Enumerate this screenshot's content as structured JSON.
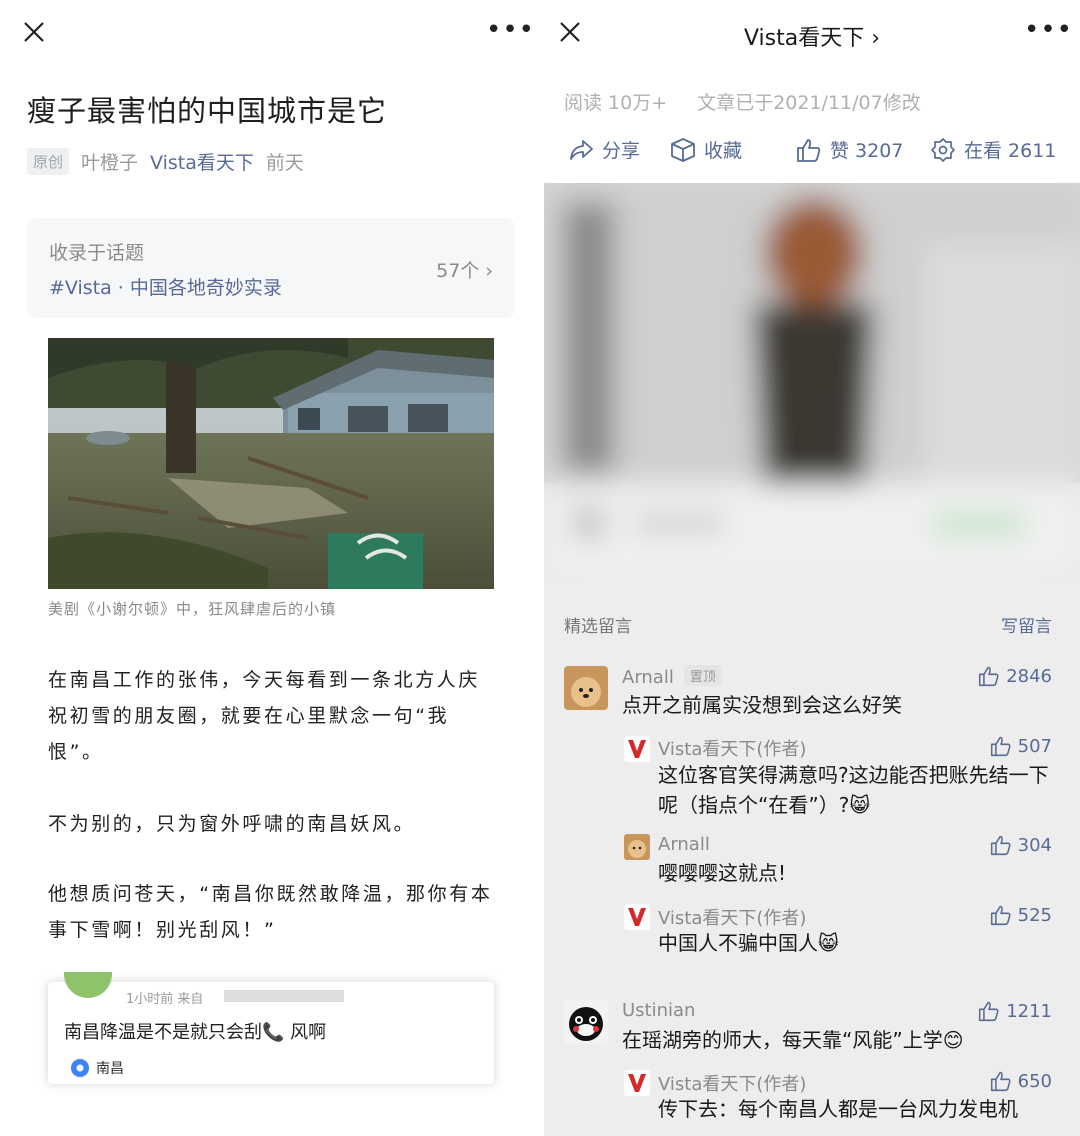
{
  "left": {
    "title": "瘦子最害怕的中国城市是它",
    "meta": {
      "original_tag": "原创",
      "author": "叶橙子",
      "account": "Vista看天下",
      "time": "前天"
    },
    "topic": {
      "label": "收录于话题",
      "name": "#Vista · 中国各地奇妙实录",
      "count": "57个 ›"
    },
    "photo_caption": "美剧《小谢尔顿》中，狂风肆虐后的小镇",
    "paragraphs": [
      "在南昌工作的张伟，今天每看到一条北方人庆祝初雪的朋友圈，就要在心里默念一句“我恨”。",
      "不为别的，只为窗外呼啸的南昌妖风。",
      "他想质问苍天，“南昌你既然敢降温，那你有本事下雪啊！别光刮风！”"
    ],
    "embed": {
      "time": "1小时前  来自",
      "text": "南昌降温是不是就只会刮📞 风啊",
      "location": "南昌"
    }
  },
  "right": {
    "header_title": "Vista看天下 ›",
    "stats": {
      "reads": "阅读 10万+",
      "modified": "文章已于2021/11/07修改"
    },
    "actions": {
      "share": "分享",
      "collect": "收藏",
      "like": "赞 3207",
      "watching": "在看 2611"
    },
    "section_title": "精选留言",
    "write_comment": "写留言",
    "comments": [
      {
        "name": "Arnall",
        "pin": "置顶",
        "likes": "2846",
        "text": "点开之前属实没想到会这么好笑"
      },
      {
        "name": "Vista看天下(作者)",
        "likes": "507",
        "text": "这位客官笑得满意吗?这边能否把账先结一下呢（指点个“在看”）?😸"
      },
      {
        "name": "Arnall",
        "likes": "304",
        "text": "嘤嘤嘤这就点!"
      },
      {
        "name": "Vista看天下(作者)",
        "likes": "525",
        "text": "中国人不骗中国人😸"
      },
      {
        "name": "Ustinian",
        "likes": "1211",
        "text": "在瑶湖旁的师大，每天靠“风能”上学😊"
      },
      {
        "name": "Vista看天下(作者)",
        "likes": "650",
        "text": "传下去：每个南昌人都是一台风力发电机"
      }
    ]
  },
  "colors": {
    "link": "#576b95",
    "muted": "#9a9a9a",
    "brand_red": "#d42a2a"
  },
  "icons": [
    "close-icon",
    "more-icon",
    "chevron-right-icon",
    "share-icon",
    "box-icon",
    "thumbs-up-icon",
    "eye-gear-icon",
    "location-pin-icon",
    "author-v-icon"
  ]
}
